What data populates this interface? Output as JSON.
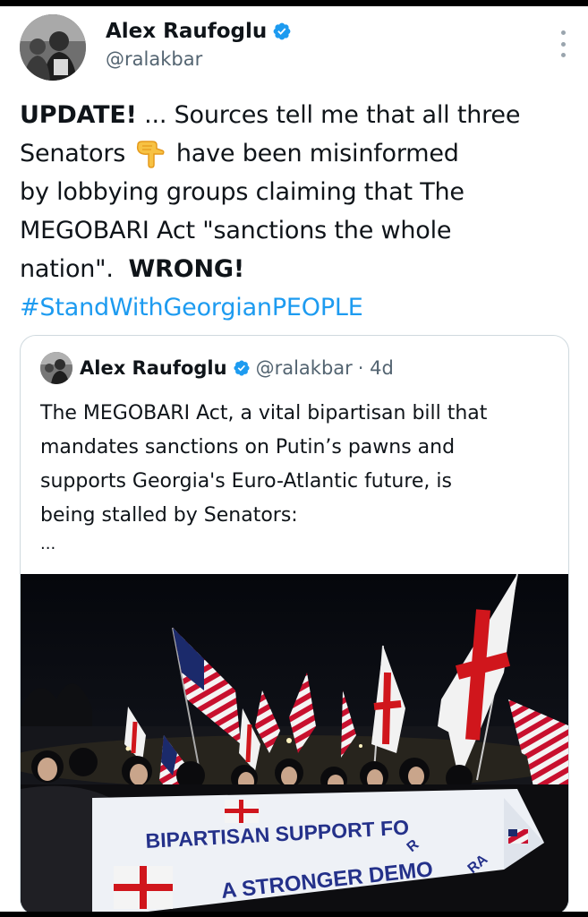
{
  "tweet": {
    "author": {
      "display_name": "Alex Raufoglu",
      "handle": "@ralakbar",
      "verified": true,
      "avatar_icon": "profile-photo"
    },
    "text": {
      "line1_bold": "UPDATE!",
      "line1_rest": " ... Sources tell me that all three",
      "line2_start": "Senators",
      "emoji": "backhand-index-pointing-down",
      "line2_end": "have been misinformed",
      "line3": "by lobbying groups claiming that The",
      "line4": "MEGOBARI Act \"sanctions the whole",
      "line5_start": "nation\".",
      "line5_bold": "WRONG!",
      "hashtag": "#StandWithGeorgianPEOPLE"
    },
    "more_icon": "more-vertical-icon"
  },
  "quote": {
    "author": {
      "display_name": "Alex Raufoglu",
      "handle": "@ralakbar",
      "time": "· 4d",
      "verified": true
    },
    "text_lines": [
      "The MEGOBARI Act, a vital bipartisan bill that",
      "mandates sanctions on Putin’s pawns and",
      "supports Georgia's Euro-Atlantic future, is",
      "being stalled by Senators:"
    ],
    "ellipsis": "...",
    "photo": {
      "banner_line1": "BIPARTISAN SUPPORT FO",
      "banner_line2": "A STRONGER DEMO",
      "banner_tail_1": "R",
      "banner_tail_2": "RA"
    }
  },
  "colors": {
    "accent": "#1d9bf0",
    "verified": "#1d9bf0",
    "text": "#0f1419",
    "secondary": "#536471",
    "border": "#cfd9de"
  }
}
